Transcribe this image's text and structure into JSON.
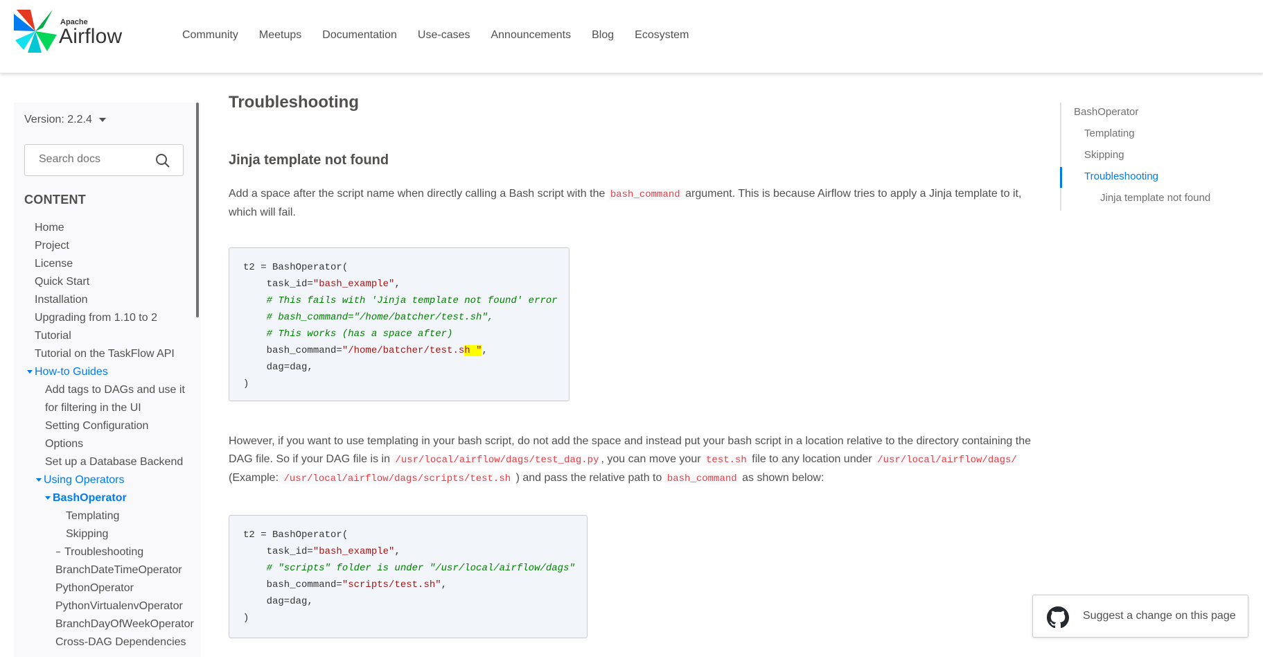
{
  "header": {
    "logo_small": "Apache",
    "logo_name": "Airflow",
    "nav": [
      "Community",
      "Meetups",
      "Documentation",
      "Use-cases",
      "Announcements",
      "Blog",
      "Ecosystem"
    ]
  },
  "sidebar": {
    "version_label": "Version: 2.2.4",
    "search_placeholder": "Search docs",
    "content_heading": "CONTENT",
    "items": [
      {
        "label": "Home"
      },
      {
        "label": "Project"
      },
      {
        "label": "License"
      },
      {
        "label": "Quick Start"
      },
      {
        "label": "Installation"
      },
      {
        "label": "Upgrading from 1.10 to 2"
      },
      {
        "label": "Tutorial"
      },
      {
        "label": "Tutorial on the TaskFlow API"
      },
      {
        "label": "How-to Guides"
      },
      {
        "label": "Add tags to DAGs and use it"
      },
      {
        "label": "for filtering in the UI"
      },
      {
        "label": "Setting Configuration"
      },
      {
        "label": "Options"
      },
      {
        "label": "Set up a Database Backend"
      },
      {
        "label": "Using Operators"
      },
      {
        "label": "BashOperator"
      },
      {
        "label": "Templating"
      },
      {
        "label": "Skipping"
      },
      {
        "label": "Troubleshooting"
      },
      {
        "label": "BranchDateTimeOperator"
      },
      {
        "label": "PythonOperator"
      },
      {
        "label": "PythonVirtualenvOperator"
      },
      {
        "label": "BranchDayOfWeekOperator"
      },
      {
        "label": "Cross-DAG Dependencies"
      }
    ]
  },
  "main": {
    "title": "Troubleshooting",
    "section_title": "Jinja template not found",
    "para1": {
      "before": "Add a space after the script name when directly calling a Bash script with the",
      "code": "bash_command",
      "after_line1": "argument. This is because Airflow tries to apply a Jinja template to it,",
      "after_line2": "which will fail."
    },
    "code1": {
      "l1": "t2 = BashOperator(",
      "l2a": "    task_id=",
      "l2b": "\"bash_example\"",
      "l2c": ",",
      "l3": "    # This fails with 'Jinja template not found' error",
      "l4": "    # bash_command=\"/home/batcher/test.sh\",",
      "l5": "    # This works (has a space after)",
      "l6a": "    bash_command=",
      "l6b": "\"/home/batcher/test.s",
      "l6c": "h \"",
      "l6d": ",",
      "l7": "    dag=dag,",
      "l8": ")"
    },
    "para2": {
      "line1": "However, if you want to use templating in your bash script, do not add the space and instead put your bash script in a location relative to the directory containing the",
      "l2_t1": "DAG file. So if your DAG file is in",
      "l2_c1": "/usr/local/airflow/dags/test_dag.py",
      "l2_t2": ", you can move your",
      "l2_c2": "test.sh",
      "l2_t3": "file to any location under",
      "l2_c3": "/usr/local/airflow/dags/",
      "l3_t1": "(Example:",
      "l3_c1": "/usr/local/airflow/dags/scripts/test.sh",
      "l3_t2": ") and pass the relative path to",
      "l3_c2": "bash_command",
      "l3_t3": "as shown below:"
    },
    "code2": {
      "l1": "t2 = BashOperator(",
      "l2a": "    task_id=",
      "l2b": "\"bash_example\"",
      "l2c": ",",
      "l3": "    # \"scripts\" folder is under \"/usr/local/airflow/dags\"",
      "l4a": "    bash_command=",
      "l4b": "\"scripts/test.sh\"",
      "l4c": ",",
      "l5": "    dag=dag,",
      "l6": ")"
    }
  },
  "right_toc": {
    "items": [
      "BashOperator",
      "Templating",
      "Skipping",
      "Troubleshooting",
      "Jinja template not found"
    ]
  },
  "suggest": {
    "label": "Suggest a change on this page",
    "icon": "github-icon"
  },
  "colors": {
    "accent": "#017cee",
    "code_red": "#e83e42",
    "comment_green": "#008000"
  }
}
